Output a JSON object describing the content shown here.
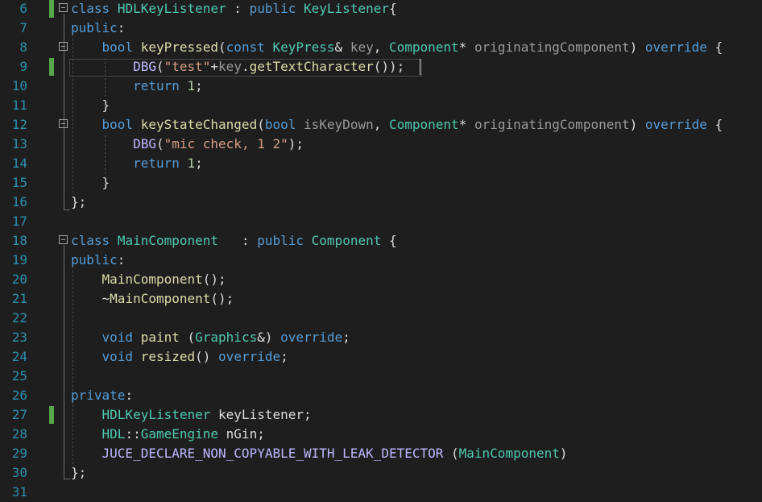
{
  "editor": {
    "lines": [
      {
        "n": "6",
        "t": [
          [
            "kw",
            "class"
          ],
          [
            "pl",
            " "
          ],
          [
            "ty",
            "HDLKeyListener"
          ],
          [
            "pl",
            " : "
          ],
          [
            "kw",
            "public"
          ],
          [
            "pl",
            " "
          ],
          [
            "ty",
            "KeyListener"
          ],
          [
            "pl",
            "{"
          ]
        ]
      },
      {
        "n": "7",
        "t": [
          [
            "kw",
            "public"
          ],
          [
            "pl",
            ":"
          ]
        ]
      },
      {
        "n": "8",
        "t": [
          [
            "pl",
            "    "
          ],
          [
            "kw",
            "bool"
          ],
          [
            "pl",
            " "
          ],
          [
            "fn",
            "keyPressed"
          ],
          [
            "pl",
            "("
          ],
          [
            "kw",
            "const"
          ],
          [
            "pl",
            " "
          ],
          [
            "ty",
            "KeyPress"
          ],
          [
            "pl",
            "& "
          ],
          [
            "par",
            "key"
          ],
          [
            "pl",
            ", "
          ],
          [
            "ty",
            "Component"
          ],
          [
            "pl",
            "* "
          ],
          [
            "par",
            "originatingComponent"
          ],
          [
            "pl",
            ") "
          ],
          [
            "kw",
            "override"
          ],
          [
            "pl",
            " {"
          ]
        ]
      },
      {
        "n": "9",
        "t": [
          [
            "pl",
            "        "
          ],
          [
            "mac",
            "DBG"
          ],
          [
            "pl",
            "("
          ],
          [
            "str",
            "\"test\""
          ],
          [
            "pl",
            "+"
          ],
          [
            "par",
            "key"
          ],
          [
            "pl",
            "."
          ],
          [
            "fn",
            "getTextCharacter"
          ],
          [
            "pl",
            "());"
          ]
        ]
      },
      {
        "n": "10",
        "t": [
          [
            "pl",
            "        "
          ],
          [
            "kw",
            "return"
          ],
          [
            "pl",
            " "
          ],
          [
            "num",
            "1"
          ],
          [
            "pl",
            ";"
          ]
        ]
      },
      {
        "n": "11",
        "t": [
          [
            "pl",
            "    }"
          ]
        ]
      },
      {
        "n": "12",
        "t": [
          [
            "pl",
            "    "
          ],
          [
            "kw",
            "bool"
          ],
          [
            "pl",
            " "
          ],
          [
            "fn",
            "keyStateChanged"
          ],
          [
            "pl",
            "("
          ],
          [
            "kw",
            "bool"
          ],
          [
            "pl",
            " "
          ],
          [
            "par",
            "isKeyDown"
          ],
          [
            "pl",
            ", "
          ],
          [
            "ty",
            "Component"
          ],
          [
            "pl",
            "* "
          ],
          [
            "par",
            "originatingComponent"
          ],
          [
            "pl",
            ") "
          ],
          [
            "kw",
            "override"
          ],
          [
            "pl",
            " {"
          ]
        ]
      },
      {
        "n": "13",
        "t": [
          [
            "pl",
            "        "
          ],
          [
            "mac",
            "DBG"
          ],
          [
            "pl",
            "("
          ],
          [
            "str",
            "\"mic check, 1 2\""
          ],
          [
            "pl",
            ");"
          ]
        ]
      },
      {
        "n": "14",
        "t": [
          [
            "pl",
            "        "
          ],
          [
            "kw",
            "return"
          ],
          [
            "pl",
            " "
          ],
          [
            "num",
            "1"
          ],
          [
            "pl",
            ";"
          ]
        ]
      },
      {
        "n": "15",
        "t": [
          [
            "pl",
            "    }"
          ]
        ]
      },
      {
        "n": "16",
        "t": [
          [
            "pl",
            "};"
          ]
        ]
      },
      {
        "n": "17",
        "t": []
      },
      {
        "n": "18",
        "t": [
          [
            "kw",
            "class"
          ],
          [
            "pl",
            " "
          ],
          [
            "ty",
            "MainComponent"
          ],
          [
            "pl",
            "   : "
          ],
          [
            "kw",
            "public"
          ],
          [
            "pl",
            " "
          ],
          [
            "ty",
            "Component"
          ],
          [
            "pl",
            " {"
          ]
        ]
      },
      {
        "n": "19",
        "t": [
          [
            "kw",
            "public"
          ],
          [
            "pl",
            ":"
          ]
        ]
      },
      {
        "n": "20",
        "t": [
          [
            "pl",
            "    "
          ],
          [
            "fn",
            "MainComponent"
          ],
          [
            "pl",
            "();"
          ]
        ]
      },
      {
        "n": "21",
        "t": [
          [
            "pl",
            "    ~"
          ],
          [
            "fn",
            "MainComponent"
          ],
          [
            "pl",
            "();"
          ]
        ]
      },
      {
        "n": "22",
        "t": []
      },
      {
        "n": "23",
        "t": [
          [
            "pl",
            "    "
          ],
          [
            "kw",
            "void"
          ],
          [
            "pl",
            " "
          ],
          [
            "fn",
            "paint"
          ],
          [
            "pl",
            " ("
          ],
          [
            "ty",
            "Graphics"
          ],
          [
            "pl",
            "&) "
          ],
          [
            "kw",
            "override"
          ],
          [
            "pl",
            ";"
          ]
        ]
      },
      {
        "n": "24",
        "t": [
          [
            "pl",
            "    "
          ],
          [
            "kw",
            "void"
          ],
          [
            "pl",
            " "
          ],
          [
            "fn",
            "resized"
          ],
          [
            "pl",
            "() "
          ],
          [
            "kw",
            "override"
          ],
          [
            "pl",
            ";"
          ]
        ]
      },
      {
        "n": "25",
        "t": []
      },
      {
        "n": "26",
        "t": [
          [
            "kw",
            "private"
          ],
          [
            "pl",
            ":"
          ]
        ]
      },
      {
        "n": "27",
        "t": [
          [
            "pl",
            "    "
          ],
          [
            "ty",
            "HDLKeyListener"
          ],
          [
            "pl",
            " keyListener;"
          ]
        ]
      },
      {
        "n": "28",
        "t": [
          [
            "pl",
            "    "
          ],
          [
            "ty",
            "HDL"
          ],
          [
            "pl",
            "::"
          ],
          [
            "ty",
            "GameEngine"
          ],
          [
            "pl",
            " nGin;"
          ]
        ]
      },
      {
        "n": "29",
        "t": [
          [
            "pl",
            "    "
          ],
          [
            "mac",
            "JUCE_DECLARE_NON_COPYABLE_WITH_LEAK_DETECTOR"
          ],
          [
            "pl",
            " ("
          ],
          [
            "ty",
            "MainComponent"
          ],
          [
            "pl",
            ")"
          ]
        ]
      },
      {
        "n": "30",
        "t": [
          [
            "pl",
            "};"
          ]
        ]
      },
      {
        "n": "31",
        "t": []
      }
    ],
    "modified_lines": [
      "6",
      "9",
      "27"
    ],
    "fold_lines": [
      "6",
      "8",
      "12",
      "18"
    ],
    "current_line": "9",
    "colors": {
      "background": "#1e1e1e",
      "line_number": "#2b91af",
      "keyword": "#569cd6",
      "type": "#4ec9b0",
      "function": "#dcdcaa",
      "macro": "#beb7ff",
      "string": "#d69d85",
      "number": "#b5cea8",
      "parameter": "#9a9a9a",
      "change_marker": "#57a64a"
    }
  }
}
